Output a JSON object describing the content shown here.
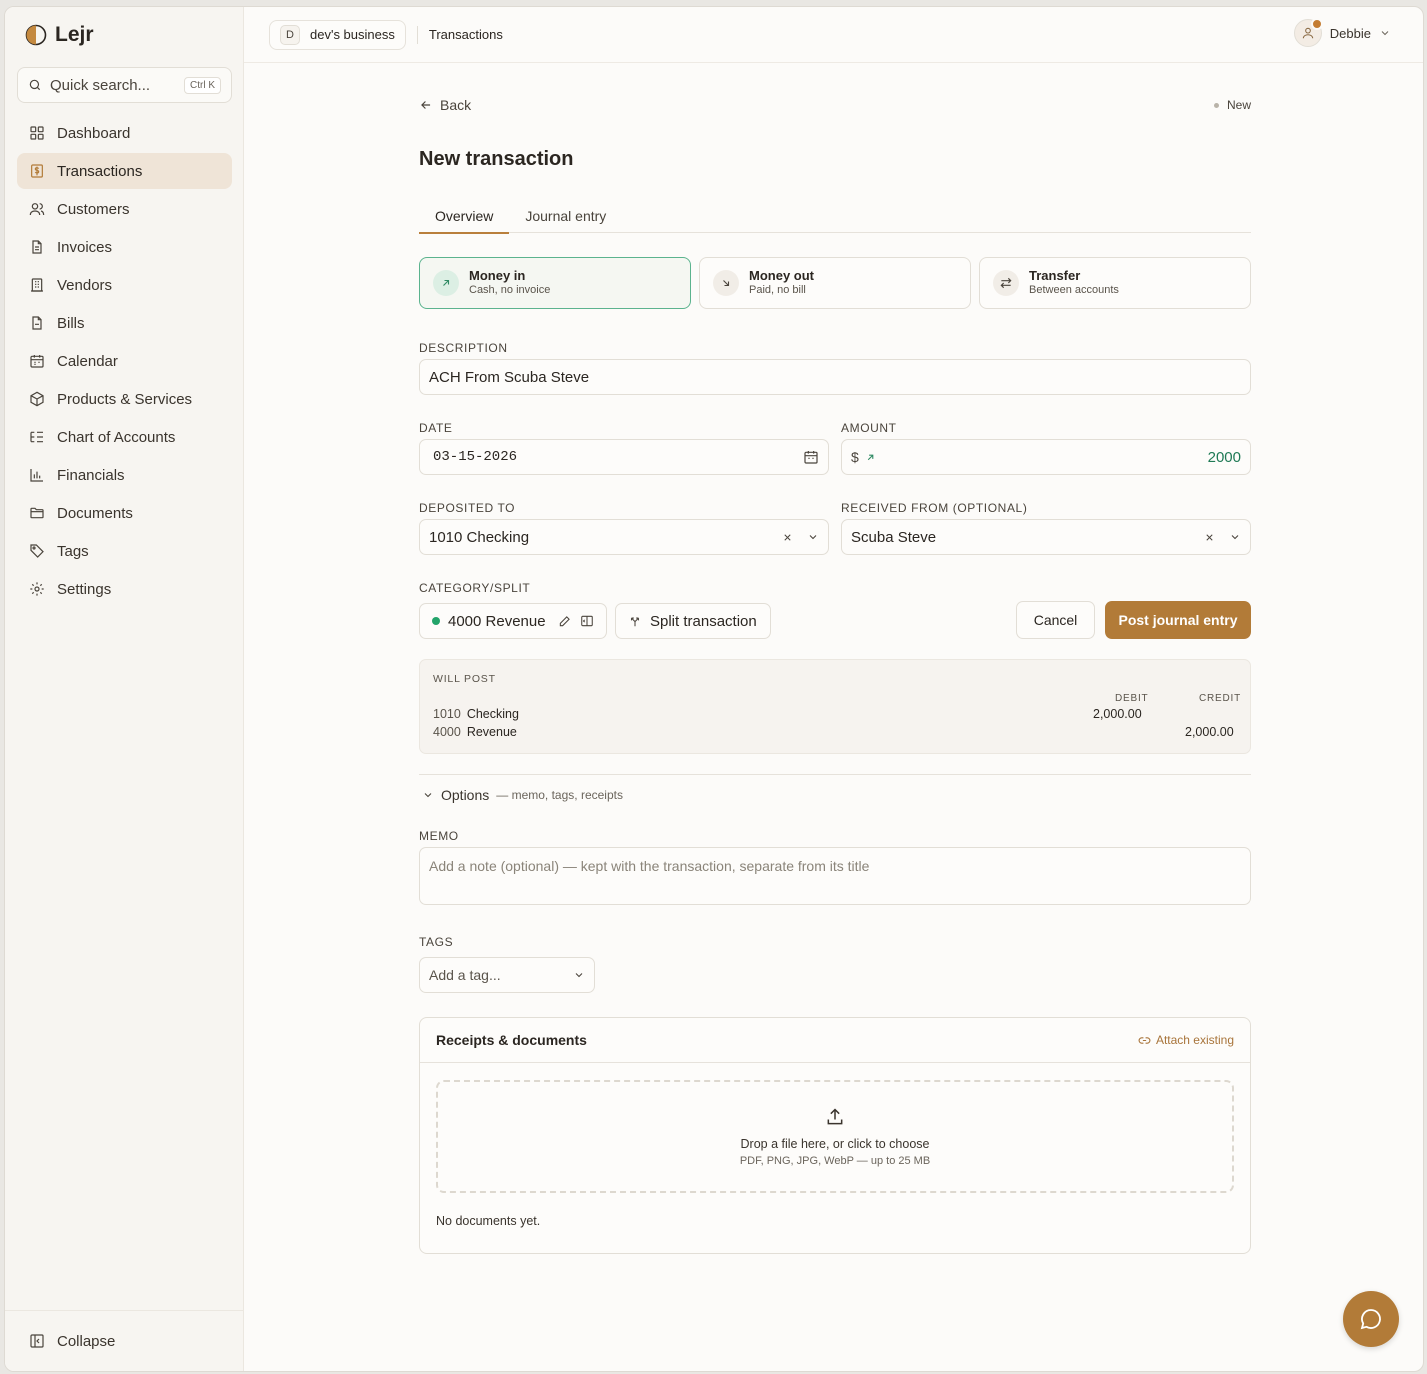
{
  "app": {
    "name": "Lejr"
  },
  "search": {
    "placeholder": "Quick search...",
    "shortcut": "Ctrl K"
  },
  "sidebar": {
    "items": [
      {
        "label": "Dashboard",
        "icon": "grid-icon"
      },
      {
        "label": "Transactions",
        "icon": "dollar-receipt-icon",
        "active": true
      },
      {
        "label": "Customers",
        "icon": "users-icon"
      },
      {
        "label": "Invoices",
        "icon": "file-text-icon"
      },
      {
        "label": "Vendors",
        "icon": "building-icon"
      },
      {
        "label": "Bills",
        "icon": "file-icon"
      },
      {
        "label": "Calendar",
        "icon": "calendar-icon"
      },
      {
        "label": "Products & Services",
        "icon": "package-icon"
      },
      {
        "label": "Chart of Accounts",
        "icon": "list-tree-icon"
      },
      {
        "label": "Financials",
        "icon": "bar-chart-icon"
      },
      {
        "label": "Documents",
        "icon": "folder-icon"
      },
      {
        "label": "Tags",
        "icon": "tag-icon"
      },
      {
        "label": "Settings",
        "icon": "gear-icon"
      }
    ],
    "collapse_label": "Collapse"
  },
  "topbar": {
    "business_initial": "D",
    "business_name": "dev's business",
    "breadcrumb": "Transactions",
    "user_name": "Debbie"
  },
  "page": {
    "back_label": "Back",
    "status": "New",
    "title": "New transaction",
    "tabs": [
      {
        "label": "Overview",
        "active": true
      },
      {
        "label": "Journal entry"
      }
    ]
  },
  "types": [
    {
      "title": "Money in",
      "subtitle": "Cash, no invoice",
      "icon": "arrow-up-right-icon",
      "active": true
    },
    {
      "title": "Money out",
      "subtitle": "Paid, no bill",
      "icon": "arrow-down-right-icon"
    },
    {
      "title": "Transfer",
      "subtitle": "Between accounts",
      "icon": "arrows-left-right-icon"
    }
  ],
  "form": {
    "description_label": "DESCRIPTION",
    "description_value": "ACH From Scuba Steve",
    "date_label": "DATE",
    "date_value": "03-15-2026",
    "amount_label": "AMOUNT",
    "amount_currency": "$",
    "amount_value": "2000",
    "deposited_label": "DEPOSITED TO",
    "deposited_value": "1010 Checking",
    "received_label": "RECEIVED FROM (OPTIONAL)",
    "received_value": "Scuba Steve",
    "category_label": "CATEGORY/SPLIT",
    "category_value": "4000 Revenue",
    "split_label": "Split transaction",
    "cancel_label": "Cancel",
    "post_label": "Post journal entry"
  },
  "will_post": {
    "title": "WILL POST",
    "debit_header": "DEBIT",
    "credit_header": "CREDIT",
    "lines": [
      {
        "number": "1010",
        "name": "Checking",
        "debit": "2,000.00",
        "credit": ""
      },
      {
        "number": "4000",
        "name": "Revenue",
        "debit": "",
        "credit": "2,000.00"
      }
    ]
  },
  "options": {
    "label": "Options",
    "hint": "— memo, tags, receipts",
    "memo_label": "MEMO",
    "memo_placeholder": "Add a note (optional) — kept with the transaction, separate from its title",
    "tags_label": "TAGS",
    "tags_placeholder": "Add a tag..."
  },
  "documents": {
    "title": "Receipts & documents",
    "attach_label": "Attach existing",
    "drop_text": "Drop a file here, or click to choose",
    "drop_hint": "PDF, PNG, JPG, WebP — up to 25 MB",
    "empty_text": "No documents yet."
  },
  "colors": {
    "accent": "#b27b38",
    "sidebar_active": "#efe4d7",
    "money_in": "#5bb38e",
    "amount": "#1f7a55"
  }
}
